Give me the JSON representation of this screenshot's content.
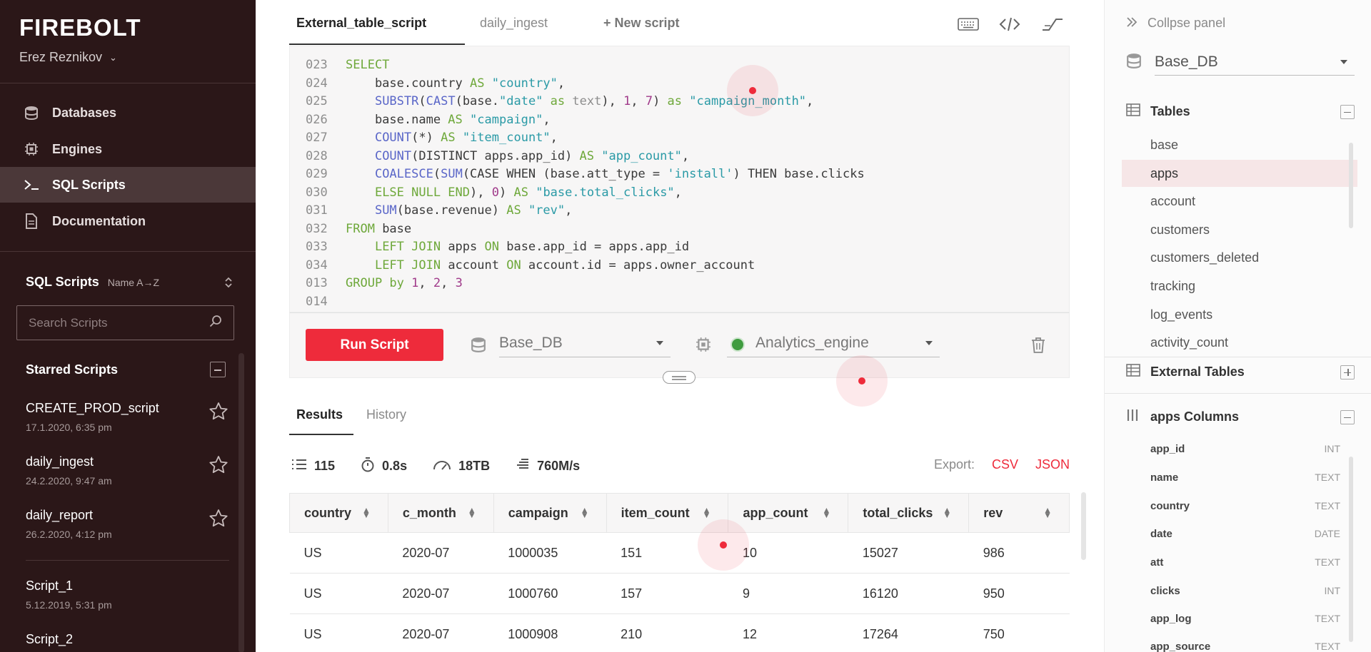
{
  "app": {
    "logo": "FIREBOLT",
    "user": "Erez Reznikov"
  },
  "nav": [
    {
      "label": "Databases",
      "icon": "database-icon"
    },
    {
      "label": "Engines",
      "icon": "engine-icon"
    },
    {
      "label": "SQL Scripts",
      "icon": "terminal-icon",
      "active": true
    },
    {
      "label": "Documentation",
      "icon": "document-icon"
    }
  ],
  "scripts_panel": {
    "title": "SQL Scripts",
    "sort_label": "Name A→Z",
    "search_placeholder": "Search Scripts",
    "starred_title": "Starred Scripts",
    "starred": [
      {
        "name": "CREATE_PROD_script",
        "date": "17.1.2020, 6:35 pm"
      },
      {
        "name": "daily_ingest",
        "date": "24.2.2020, 9:47 am"
      },
      {
        "name": "daily_report",
        "date": "26.2.2020, 4:12 pm"
      }
    ],
    "others": [
      {
        "name": "Script_1",
        "date": "5.12.2019, 5:31 pm"
      },
      {
        "name": "Script_2",
        "date": ""
      }
    ]
  },
  "tabs": [
    {
      "label": "External_table_script",
      "active": true
    },
    {
      "label": "daily_ingest"
    },
    {
      "label": "+ New script"
    }
  ],
  "editor": {
    "lines": [
      {
        "n": "023",
        "text": "SELECT"
      },
      {
        "n": "024",
        "text": "    base.country AS \"country\","
      },
      {
        "n": "025",
        "text": "    SUBSTR(CAST(base.\"date\" as text), 1, 7) as \"campaign_month\","
      },
      {
        "n": "026",
        "text": "    base.name AS \"campaign\","
      },
      {
        "n": "027",
        "text": "    COUNT(*) AS \"item_count\","
      },
      {
        "n": "028",
        "text": "    COUNT(DISTINCT apps.app_id) AS \"app_count\","
      },
      {
        "n": "029",
        "text": "    COALESCE(SUM(CASE WHEN (base.att_type = 'install') THEN base.clicks"
      },
      {
        "n": "030",
        "text": "    ELSE NULL END), 0) AS \"base.total_clicks\","
      },
      {
        "n": "031",
        "text": "    SUM(base.revenue) AS \"rev\","
      },
      {
        "n": "032",
        "text": "FROM base"
      },
      {
        "n": "033",
        "text": "    LEFT JOIN apps ON base.app_id = apps.app_id"
      },
      {
        "n": "034",
        "text": "    LEFT JOIN account ON account.id = apps.owner_account"
      },
      {
        "n": "013",
        "text": "GROUP by 1, 2, 3"
      },
      {
        "n": "014",
        "text": ""
      }
    ]
  },
  "runbar": {
    "run_label": "Run Script",
    "database": "Base_DB",
    "engine": "Analytics_engine"
  },
  "results": {
    "tabs": [
      "Results",
      "History"
    ],
    "stats": {
      "rows": "115",
      "time": "0.8s",
      "scanned": "18TB",
      "speed": "760M/s"
    },
    "export_label": "Export:",
    "export_csv": "CSV",
    "export_json": "JSON",
    "columns": [
      "country",
      "c_month",
      "campaign",
      "item_count",
      "app_count",
      "total_clicks",
      "rev"
    ],
    "rows": [
      [
        "US",
        "2020-07",
        "1000035",
        "151",
        "10",
        "15027",
        "986"
      ],
      [
        "US",
        "2020-07",
        "1000760",
        "157",
        "9",
        "16120",
        "950"
      ],
      [
        "US",
        "2020-07",
        "1000908",
        "210",
        "12",
        "17264",
        "750"
      ]
    ]
  },
  "right_panel": {
    "collapse_label": "Collpse panel",
    "database": "Base_DB",
    "tables_title": "Tables",
    "tables": [
      "base",
      "apps",
      "account",
      "customers",
      "customers_deleted",
      "tracking",
      "log_events",
      "activity_count"
    ],
    "external_title": "External Tables",
    "columns_title": "apps Columns",
    "columns": [
      {
        "name": "app_id",
        "type": "INT"
      },
      {
        "name": "name",
        "type": "TEXT"
      },
      {
        "name": "country",
        "type": "TEXT"
      },
      {
        "name": "date",
        "type": "DATE"
      },
      {
        "name": "att",
        "type": "TEXT"
      },
      {
        "name": "clicks",
        "type": "INT"
      },
      {
        "name": "app_log",
        "type": "TEXT"
      },
      {
        "name": "app_source",
        "type": "TEXT"
      }
    ]
  },
  "colors": {
    "accent": "#ee2b3b",
    "sidebar": "#2b1718",
    "engine_status": "#3f9c3f"
  }
}
